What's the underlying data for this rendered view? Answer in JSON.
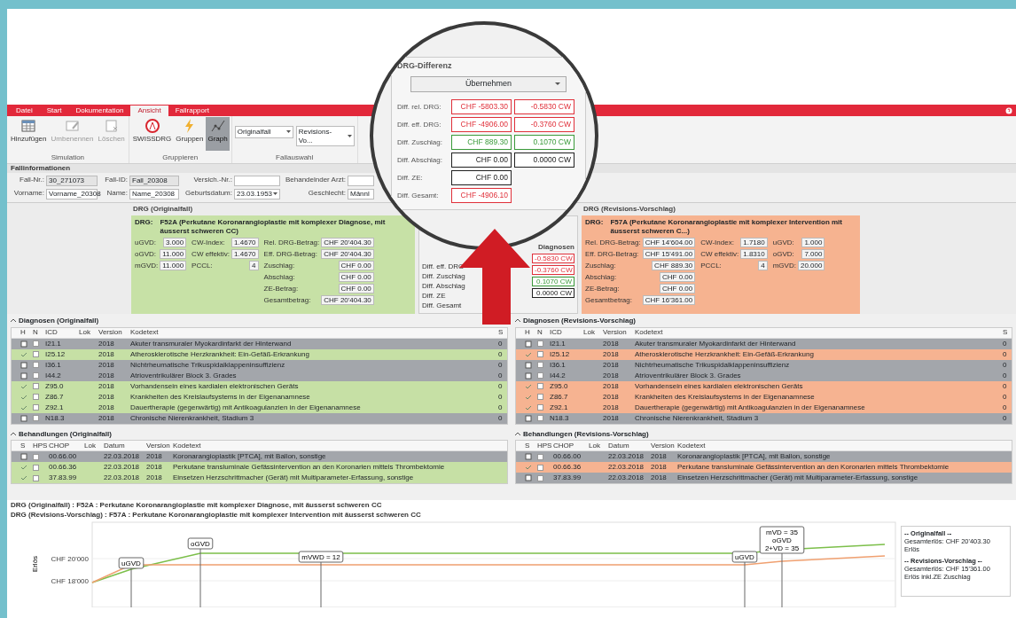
{
  "tabs": [
    {
      "label": "Datei",
      "selected": false
    },
    {
      "label": "Start",
      "selected": false
    },
    {
      "label": "Dokumentation",
      "selected": false
    },
    {
      "label": "Ansicht",
      "selected": true
    },
    {
      "label": "Fallrapport",
      "selected": false
    }
  ],
  "ribbon": {
    "groups": [
      {
        "label": "Simulation",
        "items": [
          {
            "kind": "button",
            "label": "Hinzufügen",
            "disabled": false,
            "selected": false
          },
          {
            "kind": "button",
            "label": "Umbenennen",
            "disabled": true,
            "selected": false
          },
          {
            "kind": "button",
            "label": "Löschen",
            "disabled": true,
            "selected": false
          }
        ]
      },
      {
        "label": "Gruppieren",
        "items": [
          {
            "kind": "button",
            "label": "SWISSDRG",
            "disabled": false,
            "selected": false
          },
          {
            "kind": "button",
            "label": "Gruppen",
            "disabled": false,
            "selected": false
          },
          {
            "kind": "button",
            "label": "Graph",
            "disabled": false,
            "selected": true
          }
        ]
      },
      {
        "label": "Fallauswahl",
        "items": [
          {
            "kind": "combo",
            "label": "Originalfall"
          },
          {
            "kind": "combo",
            "label": "Revisions-Vo..."
          }
        ]
      }
    ]
  },
  "case_info": {
    "title": "Fallinformationen",
    "rows": [
      [
        {
          "label": "Fall-Nr.:",
          "value": "30_271073",
          "readonly": true
        },
        {
          "label": "Fall-ID:",
          "value": "Fall_20308",
          "readonly": true
        },
        {
          "label": "Versich.-Nr.:",
          "readonly": false
        },
        {
          "label": "Behandelnder Arzt:",
          "readonly": false
        }
      ],
      [
        {
          "label": "Vorname:",
          "value": "Vorname_20308",
          "readonly": false
        },
        {
          "label": "Name:",
          "value": "Name_20308",
          "readonly": false
        },
        {
          "label": "Geburtsdatum:",
          "value": "23.03.1953",
          "readonly": false,
          "dropdown": true
        },
        {
          "label": "Geschlecht:",
          "value": "Männl",
          "readonly": false
        }
      ]
    ]
  },
  "drg_original": {
    "title": "DRG (Originalfall)",
    "drg_label": "DRG:",
    "drg_text": "F52A (Perkutane Koronarangioplastie mit komplexer Diagnose, mit äusserst schweren CC)",
    "groups": [
      [
        {
          "label": "uGVD:",
          "value": "3.000"
        },
        {
          "label": "oGVD:",
          "value": "11.000"
        },
        {
          "label": "mGVD:",
          "value": "11.000"
        }
      ],
      [
        {
          "label": "CW-Index:",
          "value": "1.4670"
        },
        {
          "label": "CW effektiv:",
          "value": "1.4670"
        },
        {
          "label": "PCCL:",
          "value": "4"
        }
      ],
      [
        {
          "label": "Rel. DRG-Betrag:",
          "value": "CHF 20'404.30"
        },
        {
          "label": "Eff. DRG-Betrag:",
          "value": "CHF 20'404.30"
        },
        {
          "label": "Zuschlag:",
          "value": "CHF 0.00"
        },
        {
          "label": "Abschlag:",
          "value": "CHF 0.00"
        },
        {
          "label": "ZE-Betrag:",
          "value": "CHF 0.00"
        },
        {
          "label": "Gesamtbetrag:",
          "value": "CHF 20'404.30"
        }
      ]
    ]
  },
  "diff_panel": {
    "title": "Diagnosen",
    "labels": [
      "Diff. eff. DRG",
      "Diff. Zuschlag",
      "Diff. Abschlag",
      "Diff. ZE",
      "Diff. Gesamt"
    ],
    "values": [
      {
        "text": "-0.5830 CW",
        "color": "#e0303a"
      },
      {
        "text": "-0.3760 CW",
        "color": "#e0303a"
      },
      {
        "text": "0.1070 CW",
        "color": "#3a9a3a"
      },
      {
        "text": "0.0000 CW",
        "color": "#222222"
      }
    ]
  },
  "drg_revision": {
    "title": "DRG (Revisions-Vorschlag)",
    "drg_label": "DRG:",
    "drg_text": "F57A (Perkutane Koronarangioplastie mit komplexer Intervention mit äusserst schweren C...)",
    "groups": [
      [
        {
          "label": "Rel. DRG-Betrag:",
          "value": "CHF 14'604.00"
        },
        {
          "label": "Eff. DRG-Betrag:",
          "value": "CHF 15'491.00"
        },
        {
          "label": "Zuschlag:",
          "value": "CHF 889.30"
        },
        {
          "label": "Abschlag:",
          "value": "CHF 0.00"
        },
        {
          "label": "ZE-Betrag:",
          "value": "CHF 0.00"
        },
        {
          "label": "Gesamtbetrag:",
          "value": "CHF 16'361.00"
        }
      ],
      [
        {
          "label": "CW-Index:",
          "value": "1.7180"
        },
        {
          "label": "CW effektiv:",
          "value": "1.8310"
        },
        {
          "label": "PCCL:",
          "value": "4"
        }
      ],
      [
        {
          "label": "uGVD:",
          "value": "1.000"
        },
        {
          "label": "oGVD:",
          "value": "7.000"
        },
        {
          "label": "mGVD:",
          "value": "20.000"
        }
      ]
    ]
  },
  "magnifier": {
    "title": "DRG-Differenz",
    "action": "Übernehmen",
    "rows": [
      {
        "label": "Diff. rel. DRG:",
        "chf": "CHF -5803.30",
        "cw": "-0.5830 CW",
        "color": "#e0303a"
      },
      {
        "label": "Diff. eff. DRG:",
        "chf": "CHF -4906.00",
        "cw": "-0.3760 CW",
        "color": "#e0303a"
      },
      {
        "label": "Diff. Zuschlag:",
        "chf": "CHF 889.30",
        "cw": "0.1070 CW",
        "color": "#3a9a3a"
      },
      {
        "label": "Diff. Abschlag:",
        "chf": "CHF 0.00",
        "cw": "0.0000 CW",
        "color": "#222222"
      },
      {
        "label": "Diff. ZE:",
        "chf": "CHF 0.00",
        "color": "#222222"
      },
      {
        "label": "Diff. Gesamt:",
        "chf": "CHF -4906.10",
        "color": "#e0303a"
      }
    ]
  },
  "tables": [
    {
      "diagnoses": {
        "title": "Diagnosen (Originalfall)",
        "columns": [
          "H",
          "N",
          "ICD",
          "Lok",
          "Version",
          "Kodetext",
          "S"
        ],
        "rows": [
          {
            "highlighted": true,
            "checked": false,
            "code": "I21.1",
            "version": "2018",
            "text": "Akuter transmuraler Myokardinfarkt der Hinterwand",
            "count": "0"
          },
          {
            "highlighted": false,
            "checked": false,
            "code": "I25.12",
            "version": "2018",
            "text": "Atherosklerotische Herzkrankheit: Ein-Gefäß-Erkrankung",
            "count": "0"
          },
          {
            "highlighted": true,
            "checked": false,
            "code": "I36.1",
            "version": "2018",
            "text": "Nichtrheumatische Trikuspidalklappeninsuffizienz",
            "count": "0"
          },
          {
            "highlighted": true,
            "checked": false,
            "code": "I44.2",
            "version": "2018",
            "text": "Atrioventrikulärer Block 3. Grades",
            "count": "0"
          },
          {
            "highlighted": false,
            "checked": false,
            "code": "Z95.0",
            "version": "2018",
            "text": "Vorhandensein eines kardialen elektronischen Geräts",
            "count": "0"
          },
          {
            "highlighted": false,
            "checked": false,
            "code": "Z86.7",
            "version": "2018",
            "text": "Krankheiten des Kreislaufsystems in der Eigenanamnese",
            "count": "0"
          },
          {
            "highlighted": false,
            "checked": false,
            "code": "Z92.1",
            "version": "2018",
            "text": "Dauertherapie (gegenwärtig) mit Antikoagulanzien in der Eigenanamnese",
            "count": "0"
          },
          {
            "highlighted": true,
            "checked": false,
            "code": "N18.3",
            "version": "2018",
            "text": "Chronische Nierenkrankheit, Stadium 3",
            "count": "0"
          }
        ]
      },
      "procedures": {
        "title": "Behandlungen (Originalfall)",
        "columns": [
          "S",
          "HPS",
          "CHOP",
          "Lok",
          "Datum",
          "Version",
          "Kodetext"
        ],
        "rows": [
          {
            "highlighted": true,
            "checked": false,
            "code": "00.66.00",
            "date": "22.03.2018",
            "version": "2018",
            "text": "Koronarangioplastik [PTCA], mit Ballon, sonstige"
          },
          {
            "highlighted": false,
            "checked": false,
            "code": "00.66.36",
            "date": "22.03.2018",
            "version": "2018",
            "text": "Perkutane transluminale Gefässintervention an den Koronarien mittels Thrombektomie"
          },
          {
            "highlighted": false,
            "checked": false,
            "code": "37.83.99",
            "date": "22.03.2018",
            "version": "2018",
            "text": "Einsetzen Herzschrittmacher (Gerät) mit Multiparameter-Erfassung, sonstige"
          }
        ]
      }
    },
    {
      "diagnoses": {
        "title": "Diagnosen (Revisions-Vorschlag)",
        "columns": [
          "H",
          "N",
          "ICD",
          "Lok",
          "Version",
          "Kodetext",
          "S"
        ],
        "rows": [
          {
            "highlighted": true,
            "checked": false,
            "code": "I21.1",
            "version": "2018",
            "text": "Akuter transmuraler Myokardinfarkt der Hinterwand",
            "count": "0"
          },
          {
            "highlighted": false,
            "checked": false,
            "code": "I25.12",
            "version": "2018",
            "text": "Atherosklerotische Herzkrankheit: Ein-Gefäß-Erkrankung",
            "count": "0"
          },
          {
            "highlighted": true,
            "checked": false,
            "code": "I36.1",
            "version": "2018",
            "text": "Nichtrheumatische Trikuspidalklappeninsuffizienz",
            "count": "0"
          },
          {
            "highlighted": true,
            "checked": false,
            "code": "I44.2",
            "version": "2018",
            "text": "Atrioventrikulärer Block 3. Grades",
            "count": "0"
          },
          {
            "highlighted": false,
            "checked": false,
            "code": "Z95.0",
            "version": "2018",
            "text": "Vorhandensein eines kardialen elektronischen Geräts",
            "count": "0"
          },
          {
            "highlighted": false,
            "checked": false,
            "code": "Z86.7",
            "version": "2018",
            "text": "Krankheiten des Kreislaufsystems in der Eigenanamnese",
            "count": "0"
          },
          {
            "highlighted": false,
            "checked": false,
            "code": "Z92.1",
            "version": "2018",
            "text": "Dauertherapie (gegenwärtig) mit Antikoagulanzien in der Eigenanamnese",
            "count": "0"
          },
          {
            "highlighted": true,
            "checked": false,
            "code": "N18.3",
            "version": "2018",
            "text": "Chronische Nierenkrankheit, Stadium 3",
            "count": "0"
          }
        ]
      },
      "procedures": {
        "title": "Behandlungen (Revisions-Vorschlag)",
        "columns": [
          "S",
          "HPS",
          "CHOP",
          "Lok",
          "Datum",
          "Version",
          "Kodetext"
        ],
        "rows": [
          {
            "highlighted": true,
            "checked": false,
            "code": "00.66.00",
            "date": "22.03.2018",
            "version": "2018",
            "text": "Koronarangioplastik [PTCA], mit Ballon, sonstige"
          },
          {
            "highlighted": false,
            "checked": false,
            "code": "00.66.36",
            "date": "22.03.2018",
            "version": "2018",
            "text": "Perkutane transluminale Gefässintervention an den Koronarien mittels Thrombektomie"
          },
          {
            "highlighted": true,
            "checked": false,
            "code": "37.83.99",
            "date": "22.03.2018",
            "version": "2018",
            "text": "Einsetzen Herzschrittmacher (Gerät) mit Multiparameter-Erfassung, sonstige"
          }
        ]
      }
    }
  ],
  "revenue_chart": {
    "headings": [
      "DRG (Originalfall) : F52A : Perkutane Koronarangioplastie mit komplexer Diagnose, mit äusserst schweren CC",
      "DRG (Revisions-Vorschlag) : F57A : Perkutane Koronarangioplastie mit komplexer Intervention mit äusserst schweren CC"
    ],
    "ylabel": "Erlös",
    "ytick_labels": [
      "CHF 20'000",
      "CHF 18'000"
    ],
    "markers": [
      {
        "lines": [
          "uGVD"
        ]
      },
      {
        "lines": [
          "oGVD"
        ]
      },
      {
        "lines": [
          "mVWD = 12"
        ]
      },
      {
        "lines": [
          "uGVD"
        ]
      },
      {
        "lines": [
          "mVD = 35",
          "oGVD",
          "2+VD = 35"
        ]
      }
    ],
    "legend": [
      {
        "title": "-- Originalfall --",
        "total": "Gesamterlös: CHF 20'403.30",
        "entry": "Erlös"
      },
      {
        "title": "-- Revisions-Vorschlag --",
        "total": "Gesamterlös: CHF 15'361.00",
        "entry": "Erlös inkl.ZE Zuschlag"
      }
    ]
  }
}
